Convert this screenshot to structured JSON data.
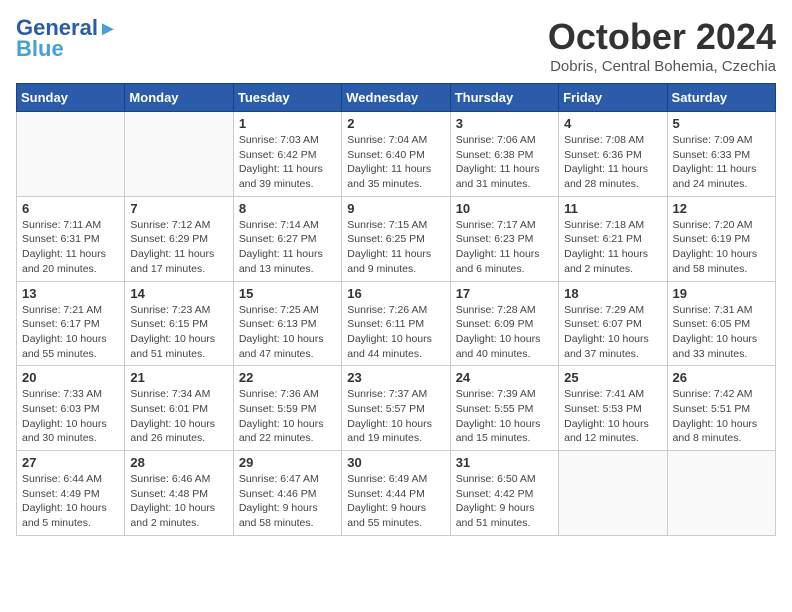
{
  "logo": {
    "line1": "General",
    "line2": "Blue"
  },
  "title": "October 2024",
  "location": "Dobris, Central Bohemia, Czechia",
  "weekdays": [
    "Sunday",
    "Monday",
    "Tuesday",
    "Wednesday",
    "Thursday",
    "Friday",
    "Saturday"
  ],
  "weeks": [
    [
      {
        "day": "",
        "info": ""
      },
      {
        "day": "",
        "info": ""
      },
      {
        "day": "1",
        "info": "Sunrise: 7:03 AM\nSunset: 6:42 PM\nDaylight: 11 hours and 39 minutes."
      },
      {
        "day": "2",
        "info": "Sunrise: 7:04 AM\nSunset: 6:40 PM\nDaylight: 11 hours and 35 minutes."
      },
      {
        "day": "3",
        "info": "Sunrise: 7:06 AM\nSunset: 6:38 PM\nDaylight: 11 hours and 31 minutes."
      },
      {
        "day": "4",
        "info": "Sunrise: 7:08 AM\nSunset: 6:36 PM\nDaylight: 11 hours and 28 minutes."
      },
      {
        "day": "5",
        "info": "Sunrise: 7:09 AM\nSunset: 6:33 PM\nDaylight: 11 hours and 24 minutes."
      }
    ],
    [
      {
        "day": "6",
        "info": "Sunrise: 7:11 AM\nSunset: 6:31 PM\nDaylight: 11 hours and 20 minutes."
      },
      {
        "day": "7",
        "info": "Sunrise: 7:12 AM\nSunset: 6:29 PM\nDaylight: 11 hours and 17 minutes."
      },
      {
        "day": "8",
        "info": "Sunrise: 7:14 AM\nSunset: 6:27 PM\nDaylight: 11 hours and 13 minutes."
      },
      {
        "day": "9",
        "info": "Sunrise: 7:15 AM\nSunset: 6:25 PM\nDaylight: 11 hours and 9 minutes."
      },
      {
        "day": "10",
        "info": "Sunrise: 7:17 AM\nSunset: 6:23 PM\nDaylight: 11 hours and 6 minutes."
      },
      {
        "day": "11",
        "info": "Sunrise: 7:18 AM\nSunset: 6:21 PM\nDaylight: 11 hours and 2 minutes."
      },
      {
        "day": "12",
        "info": "Sunrise: 7:20 AM\nSunset: 6:19 PM\nDaylight: 10 hours and 58 minutes."
      }
    ],
    [
      {
        "day": "13",
        "info": "Sunrise: 7:21 AM\nSunset: 6:17 PM\nDaylight: 10 hours and 55 minutes."
      },
      {
        "day": "14",
        "info": "Sunrise: 7:23 AM\nSunset: 6:15 PM\nDaylight: 10 hours and 51 minutes."
      },
      {
        "day": "15",
        "info": "Sunrise: 7:25 AM\nSunset: 6:13 PM\nDaylight: 10 hours and 47 minutes."
      },
      {
        "day": "16",
        "info": "Sunrise: 7:26 AM\nSunset: 6:11 PM\nDaylight: 10 hours and 44 minutes."
      },
      {
        "day": "17",
        "info": "Sunrise: 7:28 AM\nSunset: 6:09 PM\nDaylight: 10 hours and 40 minutes."
      },
      {
        "day": "18",
        "info": "Sunrise: 7:29 AM\nSunset: 6:07 PM\nDaylight: 10 hours and 37 minutes."
      },
      {
        "day": "19",
        "info": "Sunrise: 7:31 AM\nSunset: 6:05 PM\nDaylight: 10 hours and 33 minutes."
      }
    ],
    [
      {
        "day": "20",
        "info": "Sunrise: 7:33 AM\nSunset: 6:03 PM\nDaylight: 10 hours and 30 minutes."
      },
      {
        "day": "21",
        "info": "Sunrise: 7:34 AM\nSunset: 6:01 PM\nDaylight: 10 hours and 26 minutes."
      },
      {
        "day": "22",
        "info": "Sunrise: 7:36 AM\nSunset: 5:59 PM\nDaylight: 10 hours and 22 minutes."
      },
      {
        "day": "23",
        "info": "Sunrise: 7:37 AM\nSunset: 5:57 PM\nDaylight: 10 hours and 19 minutes."
      },
      {
        "day": "24",
        "info": "Sunrise: 7:39 AM\nSunset: 5:55 PM\nDaylight: 10 hours and 15 minutes."
      },
      {
        "day": "25",
        "info": "Sunrise: 7:41 AM\nSunset: 5:53 PM\nDaylight: 10 hours and 12 minutes."
      },
      {
        "day": "26",
        "info": "Sunrise: 7:42 AM\nSunset: 5:51 PM\nDaylight: 10 hours and 8 minutes."
      }
    ],
    [
      {
        "day": "27",
        "info": "Sunrise: 6:44 AM\nSunset: 4:49 PM\nDaylight: 10 hours and 5 minutes."
      },
      {
        "day": "28",
        "info": "Sunrise: 6:46 AM\nSunset: 4:48 PM\nDaylight: 10 hours and 2 minutes."
      },
      {
        "day": "29",
        "info": "Sunrise: 6:47 AM\nSunset: 4:46 PM\nDaylight: 9 hours and 58 minutes."
      },
      {
        "day": "30",
        "info": "Sunrise: 6:49 AM\nSunset: 4:44 PM\nDaylight: 9 hours and 55 minutes."
      },
      {
        "day": "31",
        "info": "Sunrise: 6:50 AM\nSunset: 4:42 PM\nDaylight: 9 hours and 51 minutes."
      },
      {
        "day": "",
        "info": ""
      },
      {
        "day": "",
        "info": ""
      }
    ]
  ]
}
